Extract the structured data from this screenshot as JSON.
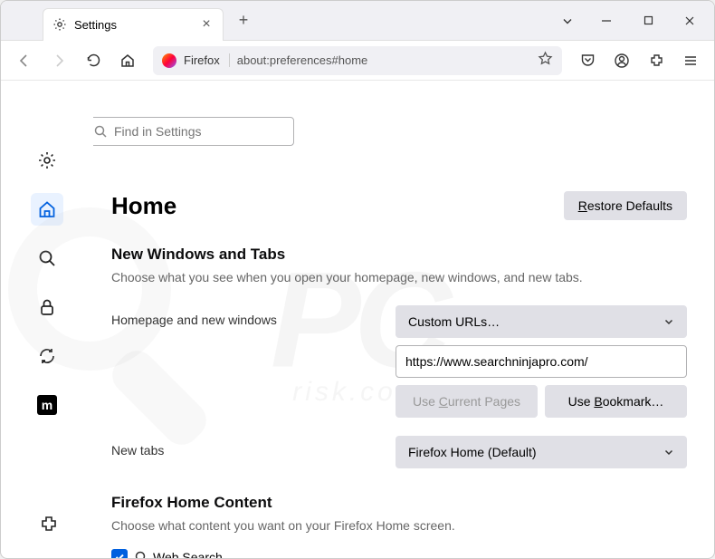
{
  "tab": {
    "title": "Settings"
  },
  "urlbar": {
    "label": "Firefox",
    "url": "about:preferences#home"
  },
  "search": {
    "placeholder": "Find in Settings"
  },
  "page": {
    "title": "Home",
    "restore_btn": "Restore Defaults",
    "restore_key": "R"
  },
  "section1": {
    "title": "New Windows and Tabs",
    "desc": "Choose what you see when you open your homepage, new windows, and new tabs."
  },
  "homepage": {
    "label": "Homepage and new windows",
    "select_value": "Custom URLs…",
    "url_value": "https://www.searchninjapro.com/",
    "use_current": "Use Current Pages",
    "use_current_key": "C",
    "use_bookmark": "Use Bookmark…",
    "use_bookmark_key": "B"
  },
  "newtabs": {
    "label": "New tabs",
    "select_value": "Firefox Home (Default)"
  },
  "section2": {
    "title": "Firefox Home Content",
    "desc": "Choose what content you want on your Firefox Home screen."
  },
  "websearch": {
    "label": "Web Search"
  },
  "moz": {
    "label": "m"
  }
}
